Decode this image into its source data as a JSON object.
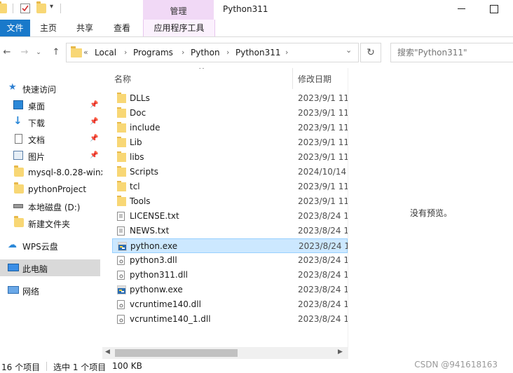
{
  "titlebar": {
    "context_group_label": "管理",
    "window_title": "Python311",
    "minimize_glyph": "—",
    "maximize_glyph": "☐"
  },
  "ribbon": {
    "tabs": [
      {
        "label": "文件"
      },
      {
        "label": "主页"
      },
      {
        "label": "共享"
      },
      {
        "label": "查看"
      },
      {
        "label": "应用程序工具"
      }
    ]
  },
  "address": {
    "overflow": "«",
    "crumbs": [
      "Local",
      "Programs",
      "Python",
      "Python311"
    ],
    "separator": "›",
    "dropdown": "⌄",
    "refresh": "↻"
  },
  "search": {
    "placeholder": "搜索\"Python311\""
  },
  "nav": {
    "items": [
      {
        "label": "快速访问"
      },
      {
        "label": "桌面"
      },
      {
        "label": "下载"
      },
      {
        "label": "文档"
      },
      {
        "label": "图片"
      },
      {
        "label": "mysql-8.0.28-winx"
      },
      {
        "label": "pythonProject"
      },
      {
        "label": "本地磁盘 (D:)"
      },
      {
        "label": "新建文件夹"
      },
      {
        "label": "WPS云盘"
      },
      {
        "label": "此电脑"
      },
      {
        "label": "网络"
      }
    ]
  },
  "files": {
    "columns": {
      "name": "名称",
      "date": "修改日期"
    },
    "sort_indicator": "^",
    "rows": [
      {
        "name": "DLLs",
        "date": "2023/9/1 11",
        "icon": "folder-icon"
      },
      {
        "name": "Doc",
        "date": "2023/9/1 11",
        "icon": "folder-icon"
      },
      {
        "name": "include",
        "date": "2023/9/1 11",
        "icon": "folder-icon"
      },
      {
        "name": "Lib",
        "date": "2023/9/1 11",
        "icon": "folder-icon"
      },
      {
        "name": "libs",
        "date": "2023/9/1 11",
        "icon": "folder-icon"
      },
      {
        "name": "Scripts",
        "date": "2024/10/14",
        "icon": "folder-icon"
      },
      {
        "name": "tcl",
        "date": "2023/9/1 11",
        "icon": "folder-icon"
      },
      {
        "name": "Tools",
        "date": "2023/9/1 11",
        "icon": "folder-icon"
      },
      {
        "name": "LICENSE.txt",
        "date": "2023/8/24 1",
        "icon": "text-file-icon"
      },
      {
        "name": "NEWS.txt",
        "date": "2023/8/24 1",
        "icon": "text-file-icon"
      },
      {
        "name": "python.exe",
        "date": "2023/8/24 1",
        "icon": "exe-icon"
      },
      {
        "name": "python3.dll",
        "date": "2023/8/24 1",
        "icon": "dll-icon"
      },
      {
        "name": "python311.dll",
        "date": "2023/8/24 1",
        "icon": "dll-icon"
      },
      {
        "name": "pythonw.exe",
        "date": "2023/8/24 1",
        "icon": "exe-icon"
      },
      {
        "name": "vcruntime140.dll",
        "date": "2023/8/24 1",
        "icon": "dll-icon"
      },
      {
        "name": "vcruntime140_1.dll",
        "date": "2023/8/24 1",
        "icon": "dll-icon"
      }
    ],
    "selected": "python.exe"
  },
  "preview": {
    "empty_text": "没有预览。"
  },
  "status": {
    "item_count": "16 个项目",
    "selection": "选中 1 个项目",
    "size": "100 KB",
    "watermark": "CSDN @941618163"
  },
  "colors": {
    "file_tab": "#1979ca",
    "context_group": "#f1d9f6",
    "selection": "#cce8ff",
    "folder": "#f8d775"
  }
}
